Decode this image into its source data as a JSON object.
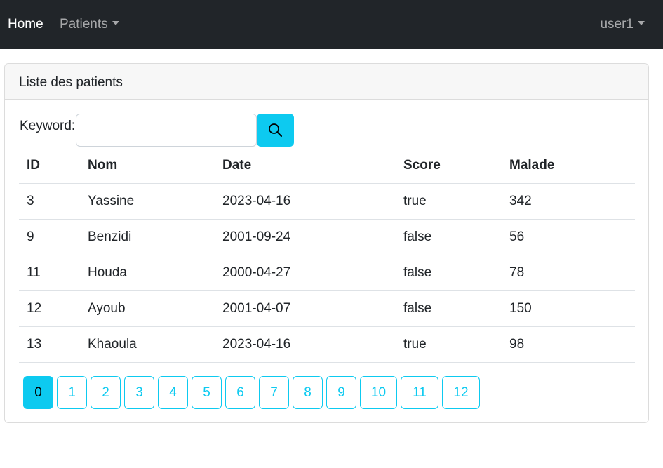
{
  "nav": {
    "home": "Home",
    "patients": "Patients",
    "user": "user1"
  },
  "card": {
    "title": "Liste des patients"
  },
  "search": {
    "label": "Keyword:",
    "value": "",
    "button_icon": "search-icon"
  },
  "table": {
    "headers": [
      "ID",
      "Nom",
      "Date",
      "Score",
      "Malade"
    ],
    "rows": [
      [
        "3",
        "Yassine",
        "2023-04-16",
        "true",
        "342"
      ],
      [
        "9",
        "Benzidi",
        "2001-09-24",
        "false",
        "56"
      ],
      [
        "11",
        "Houda",
        "2000-04-27",
        "false",
        "78"
      ],
      [
        "12",
        "Ayoub",
        "2001-04-07",
        "false",
        "150"
      ],
      [
        "13",
        "Khaoula",
        "2023-04-16",
        "true",
        "98"
      ]
    ]
  },
  "pagination": {
    "pages": [
      "0",
      "1",
      "2",
      "3",
      "4",
      "5",
      "6",
      "7",
      "8",
      "9",
      "10",
      "11",
      "12"
    ],
    "active": "0"
  },
  "colors": {
    "navbar": "#212529",
    "accent": "#0dcaf0"
  }
}
